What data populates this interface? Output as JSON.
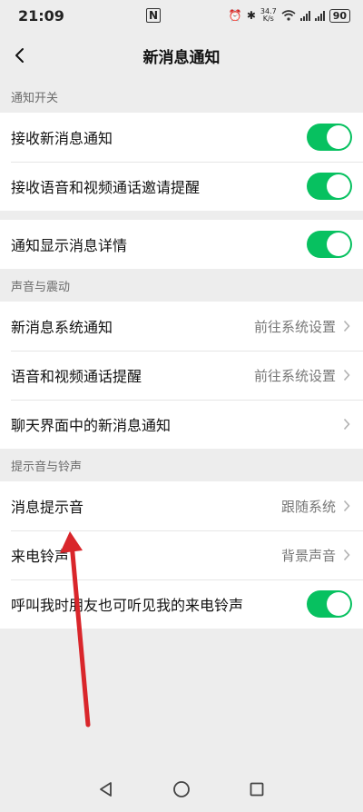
{
  "status_bar": {
    "time": "21:09",
    "nfc": "N",
    "speed_value": "34.7",
    "speed_unit": "K/s",
    "battery": "90"
  },
  "nav": {
    "title": "新消息通知",
    "back_icon": "chevron-left-icon"
  },
  "sections": {
    "notify_switch": {
      "header": "通知开关"
    },
    "sound_vibration": {
      "header": "声音与震动"
    },
    "tone_ringtone": {
      "header": "提示音与铃声"
    }
  },
  "rows": {
    "receive_new": {
      "label": "接收新消息通知",
      "toggle": true
    },
    "receive_call_invite": {
      "label": "接收语音和视频通话邀请提醒",
      "toggle": true
    },
    "show_details": {
      "label": "通知显示消息详情",
      "toggle": true
    },
    "new_msg_system": {
      "label": "新消息系统通知",
      "value": "前往系统设置"
    },
    "call_reminder": {
      "label": "语音和视频通话提醒",
      "value": "前往系统设置"
    },
    "chat_notify": {
      "label": "聊天界面中的新消息通知"
    },
    "msg_tone": {
      "label": "消息提示音",
      "value": "跟随系统"
    },
    "ringtone": {
      "label": "来电铃声",
      "value": "背景声音"
    },
    "friends_hear": {
      "label": "呼叫我时朋友也可听见我的来电铃声",
      "toggle": true
    }
  },
  "colors": {
    "toggle_on": "#07c160",
    "annotation_arrow": "#d9262b",
    "background": "#ededed"
  }
}
